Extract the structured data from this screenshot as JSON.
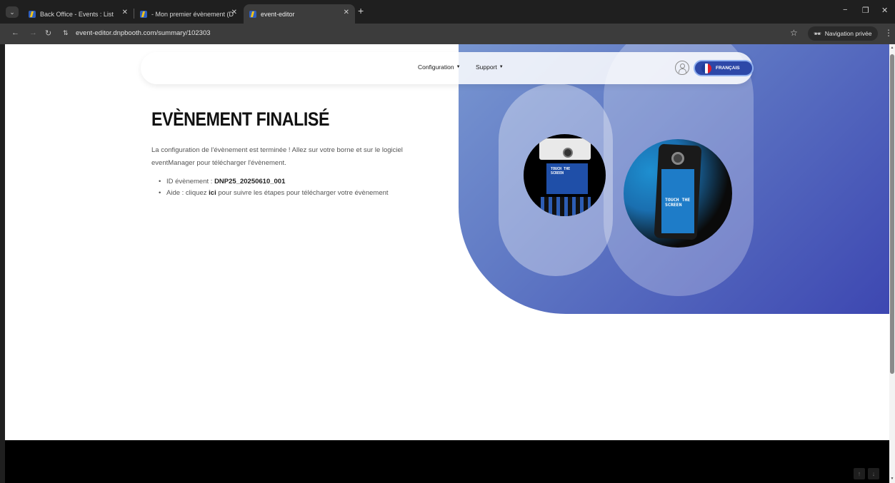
{
  "browser": {
    "tabs": [
      {
        "title": "Back Office - Events : List",
        "active": false
      },
      {
        "title": "- Mon premier évènement (DN",
        "active": false
      },
      {
        "title": "event-editor",
        "active": true
      }
    ],
    "new_tab_icon": "+",
    "url": "event-editor.dnpbooth.com/summary/102303",
    "incognito_label": "Navigation privée",
    "colors": {
      "chrome_dark": "#1f1f1f",
      "chrome_toolbar": "#3c3c3c"
    }
  },
  "header": {
    "nav": [
      {
        "label": "Configuration"
      },
      {
        "label": "Support"
      }
    ],
    "language_label": "FRANÇAIS",
    "colors": {
      "language_button": "#2d48a8"
    }
  },
  "main": {
    "title": "EVÈNEMENT FINALISÉ",
    "description": "La configuration de l'évènement est terminée ! Allez sur votre borne et sur le logiciel eventManager pour télécharger l'évènement.",
    "bullets": {
      "id_prefix": "ID évènement : ",
      "id_value": "DNP25_20250610_001",
      "help_prefix": "Aide : cliquez ",
      "help_link": "ici",
      "help_suffix": " pour suivre les étapes pour télécharger votre évènement"
    }
  },
  "hero": {
    "screen_text_1": "TOUCH THE SCREEN",
    "screen_text_2": "TOUCH THE SCREEN",
    "colors": {
      "gradient_start": "#7f9ed4",
      "gradient_end": "#3b44b0"
    }
  }
}
